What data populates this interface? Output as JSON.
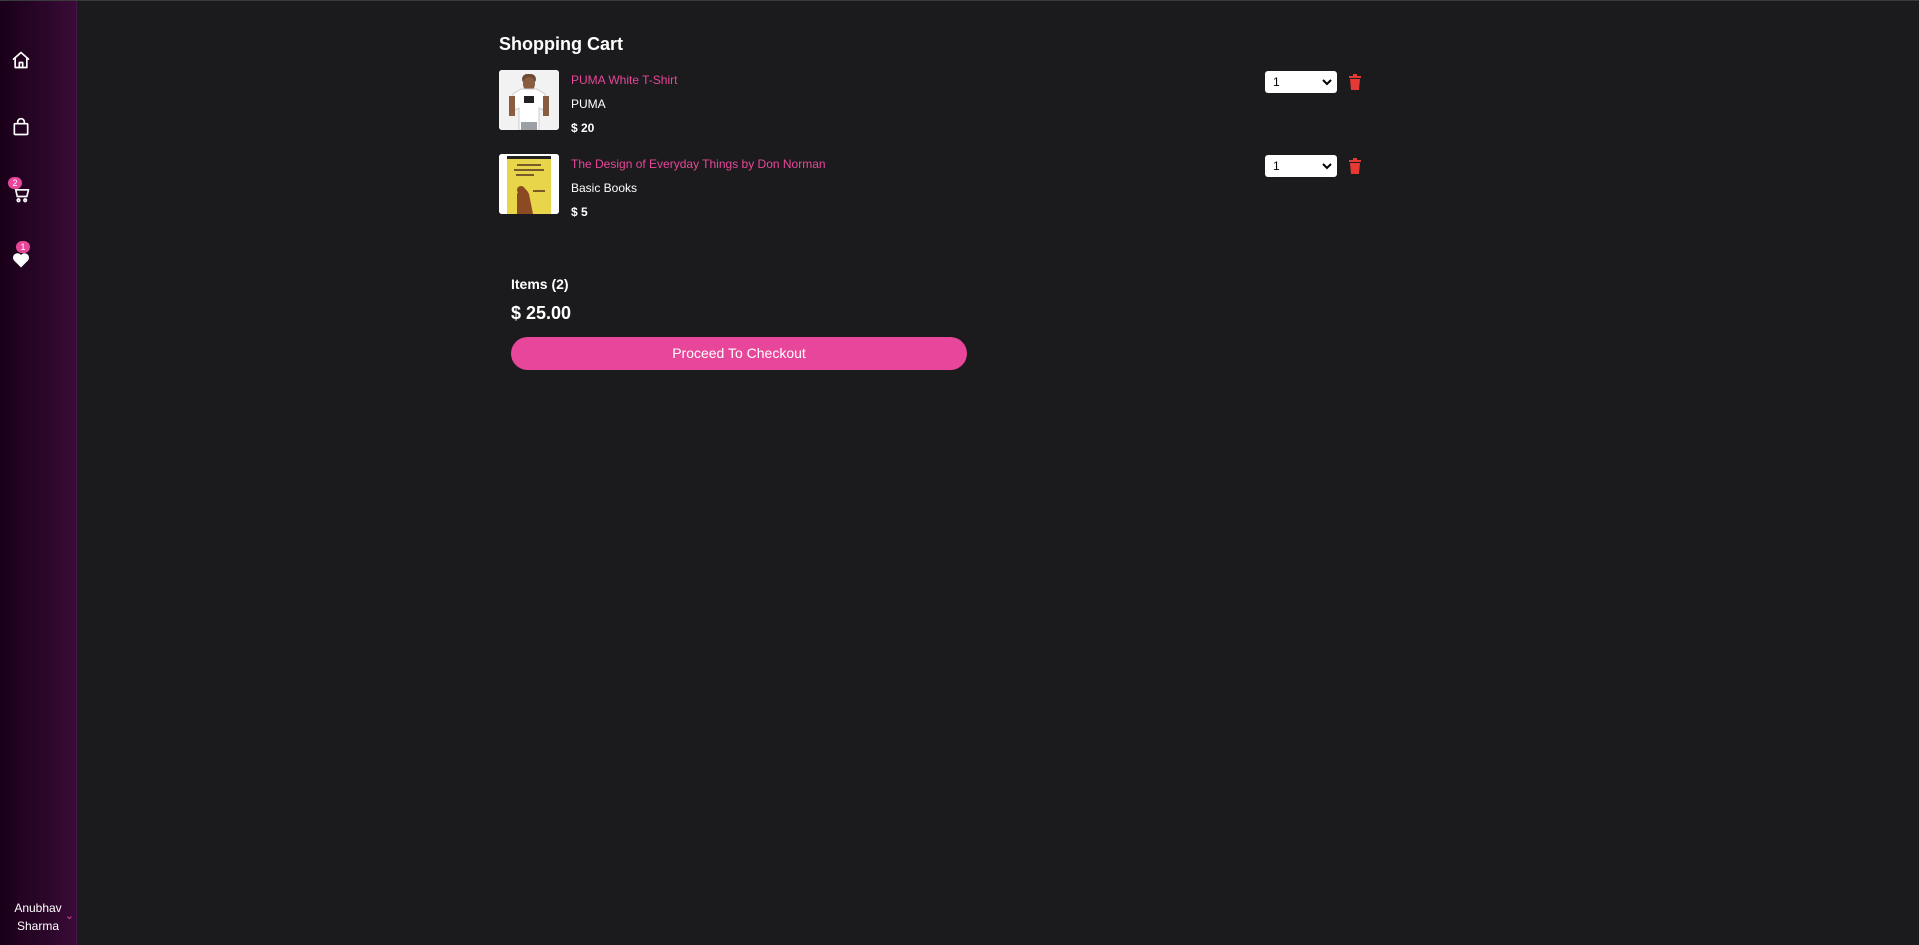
{
  "sidebar": {
    "items": [
      {
        "name": "home",
        "icon": "home-icon"
      },
      {
        "name": "shop",
        "icon": "shopping-bag-icon"
      },
      {
        "name": "cart",
        "icon": "cart-icon",
        "badge": "2"
      },
      {
        "name": "wishlist",
        "icon": "heart-icon",
        "badge": "1"
      }
    ],
    "user": {
      "first": "Anubhav",
      "last": "Sharma",
      "menu_icon": "chevron-down-icon"
    }
  },
  "cart": {
    "title": "Shopping Cart",
    "items": [
      {
        "name": "PUMA White T-Shirt",
        "brand": "PUMA",
        "price": "$ 20",
        "quantity": "1"
      },
      {
        "name": "The Design of Everyday Things by Don Norman",
        "brand": "Basic Books",
        "price": "$ 5",
        "quantity": "1"
      }
    ]
  },
  "summary": {
    "items_label": "Items (2)",
    "total": "$ 25.00",
    "checkout_label": "Proceed To Checkout"
  },
  "colors": {
    "background": "#1b1b1d",
    "accent": "#e8469a",
    "delete": "#e53935",
    "sidebar_gradient_end": "#3a0a38"
  }
}
